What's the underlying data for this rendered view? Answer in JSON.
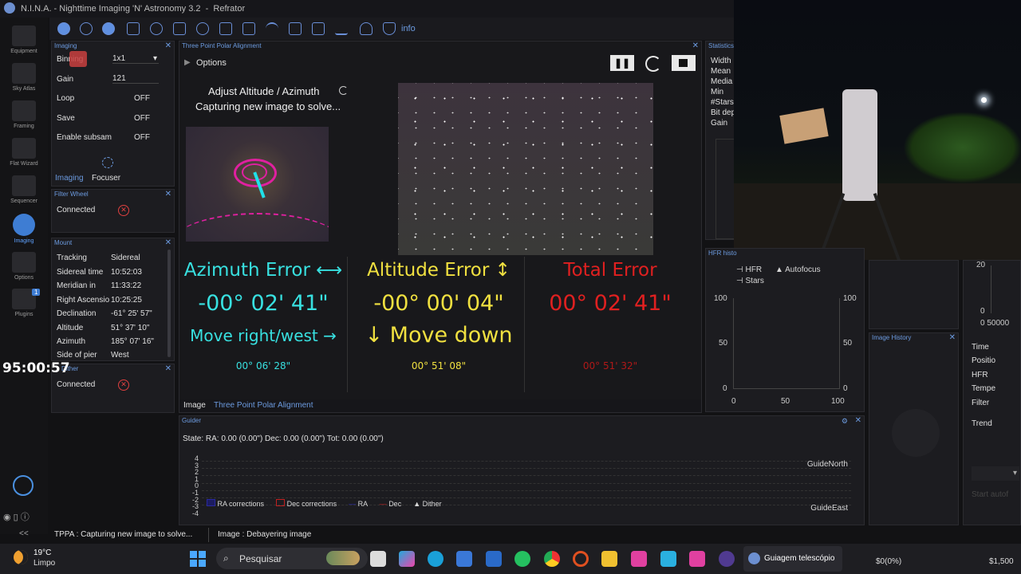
{
  "app": {
    "title": "N.I.N.A. - Nighttime Imaging 'N' Astronomy 3.2",
    "profile": "Refrator",
    "accent": "#3e7dd3"
  },
  "sidebar": {
    "items": [
      {
        "label": "Equipment",
        "icon": "telescope-icon"
      },
      {
        "label": "Sky Atlas",
        "icon": "star-map-icon"
      },
      {
        "label": "Framing",
        "icon": "framing-icon"
      },
      {
        "label": "Flat Wizard",
        "icon": "flat-wizard-icon"
      },
      {
        "label": "Sequencer",
        "icon": "sequencer-icon"
      },
      {
        "label": "Imaging",
        "icon": "camera-icon"
      },
      {
        "label": "Options",
        "icon": "gear-icon"
      },
      {
        "label": "Plugins",
        "icon": "puzzle-icon"
      }
    ],
    "plugins_badge": "1",
    "collapse": "<<"
  },
  "toolbar": {
    "info_label": "info"
  },
  "imaging_panel": {
    "title": "Imaging",
    "rows": [
      {
        "label": "Binning",
        "value": "1x1"
      },
      {
        "label": "Gain",
        "value": "121"
      },
      {
        "label": "Loop",
        "value": "OFF"
      },
      {
        "label": "Save",
        "value": "OFF"
      },
      {
        "label": "Enable subsam",
        "value": "OFF"
      }
    ],
    "tabs": [
      "Imaging",
      "Focuser"
    ]
  },
  "filter_wheel": {
    "title": "Filter Wheel",
    "status": "Connected"
  },
  "mount": {
    "title": "Mount",
    "rows": [
      {
        "label": "Tracking",
        "value": "Sidereal"
      },
      {
        "label": "Sidereal time",
        "value": "10:52:03"
      },
      {
        "label": "Meridian in",
        "value": "11:33:22"
      },
      {
        "label": "Right Ascension",
        "value": "10:25:25"
      },
      {
        "label": "Declination",
        "value": "-61° 25' 57\""
      },
      {
        "label": "Altitude",
        "value": "51° 37' 10\""
      },
      {
        "label": "Azimuth",
        "value": "185° 07' 16\""
      },
      {
        "label": "Side of pier",
        "value": "West"
      }
    ]
  },
  "ditherer": {
    "title": "Dither",
    "status": "Connected"
  },
  "timer_overlay": "95:00:57",
  "tppa": {
    "title": "Three Point Polar Alignment",
    "options_label": "Options",
    "step_title": "Adjust Altitude / Azimuth",
    "step_status": "Capturing new image to solve...",
    "azimuth": {
      "label": "Azimuth Error ⟷",
      "value": "-00° 02' 41\"",
      "move": "Move right/west →",
      "total": "00° 06' 28\"",
      "color": "#38e0e0"
    },
    "altitude": {
      "label": "Altitude Error ↕",
      "value": "-00° 00' 04\"",
      "move": "↓ Move down",
      "total": "00° 51' 08\"",
      "color": "#f0e040"
    },
    "total": {
      "label": "Total Error",
      "value": "00° 02' 41\"",
      "total": "00° 51' 32\"",
      "color": "#e02020"
    },
    "bottom_tabs": [
      "Image",
      "Three Point Polar Alignment"
    ]
  },
  "statistics": {
    "title": "Statistics",
    "rows": [
      "Width",
      "Mean",
      "Media",
      "Min",
      "#Stars",
      "Bit dep",
      "Gain"
    ]
  },
  "hfr_history": {
    "title": "HFR histo",
    "legend": [
      "HFR",
      "Autofocus",
      "Stars"
    ],
    "y_ticks": [
      "100",
      "50",
      "0"
    ],
    "x_ticks": [
      "0",
      "50",
      "100"
    ]
  },
  "image_history": {
    "title": "Image History"
  },
  "right_stats": {
    "rows": [
      "Time",
      "Positio",
      "HFR",
      "Tempe",
      "Filter",
      "Trend"
    ],
    "start_label": "Start autof",
    "ticks": [
      "20",
      "0",
      "0 50000"
    ]
  },
  "guider": {
    "title": "Guider",
    "state": "State:  RA: 0.00 (0.00\")  Dec: 0.00 (0.00\")  Tot: 0.00 (0.00\")",
    "y_ticks": [
      "4",
      "3",
      "2",
      "1",
      "0",
      "-1",
      "-2",
      "-3",
      "-4"
    ],
    "north_label": "GuideNorth",
    "east_label": "GuideEast",
    "legend": [
      "RA corrections",
      "Dec corrections",
      "RA",
      "Dec",
      "Dither"
    ]
  },
  "statusbar": {
    "tppa": "TPPA :   Capturing new image to solve...",
    "image": "Image :   Debayering image"
  },
  "taskbar": {
    "weather_temp": "19°C",
    "weather_desc": "Limpo",
    "search": "Pesquisar",
    "active_window": "Guiagem telescópio",
    "ticker_1": "$0(0%)",
    "ticker_2": "$1,500"
  }
}
